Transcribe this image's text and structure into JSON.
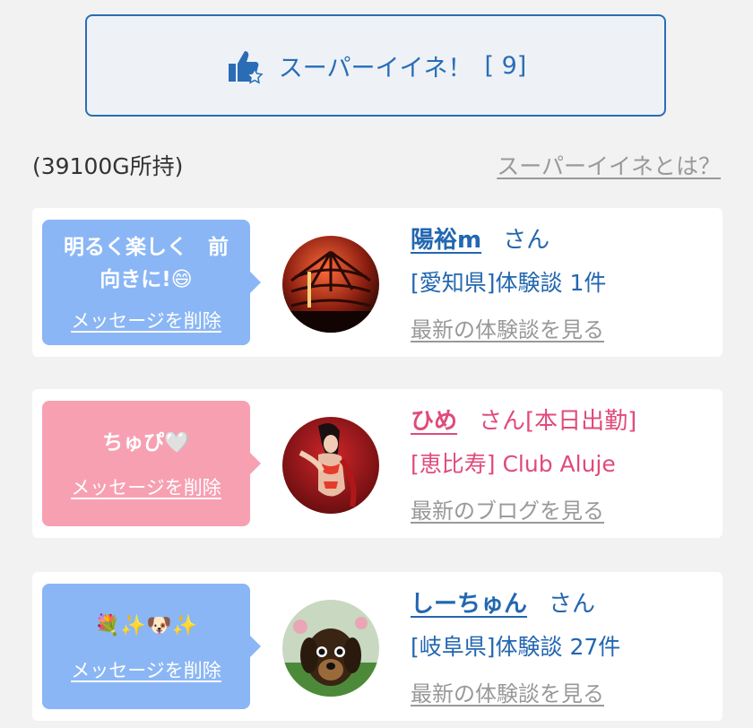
{
  "super_like": {
    "label": "スーパーイイネ！",
    "count": "[ 9]"
  },
  "balance": "(39100G所持)",
  "what_link": "スーパーイイネとは？",
  "cards": [
    {
      "message_line1": "明るく楽しく　前",
      "message_line2": "向きに!😄",
      "delete_label": "メッセージを削除",
      "name": "陽裕m",
      "honorific": "さん",
      "line2": "[愛知県]体験談 1件",
      "link": "最新の体験談を見る"
    },
    {
      "message_line1": "ちゅぴ🤍",
      "delete_label": "メッセージを削除",
      "name": "ひめ",
      "honorific": "さん[本日出勤]",
      "line2": "[恵比寿] Club Aluje",
      "link": "最新のブログを見る"
    },
    {
      "message_line1": "💐✨🐶✨",
      "delete_label": "メッセージを削除",
      "name": "しーちゅん",
      "honorific": "さん",
      "line2": "[岐阜県]体験談 27件",
      "link": "最新の体験談を見る"
    }
  ],
  "colors": {
    "accent_blue": "#2a6db5",
    "bubble_blue": "#8ab6f5",
    "bubble_pink": "#f7a0b2",
    "text_pink": "#e04b7a"
  }
}
